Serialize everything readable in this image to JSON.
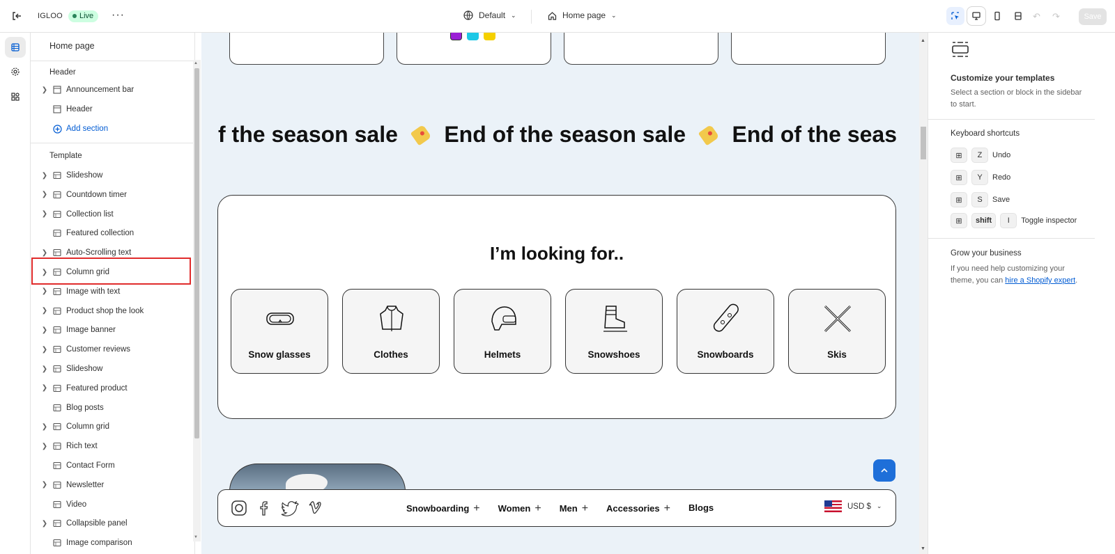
{
  "topbar": {
    "store_name": "IGLOO",
    "status": "Live",
    "more": "···",
    "theme_selector": "Default",
    "page_selector": "Home page",
    "save_label": "Save"
  },
  "sidebar": {
    "title": "Home page",
    "header_group": "Header",
    "header_items": [
      {
        "label": "Announcement bar",
        "expandable": true,
        "icon": "layout-icon"
      },
      {
        "label": "Header",
        "expandable": false,
        "icon": "layout-icon"
      }
    ],
    "add_section": "Add section",
    "template_group": "Template",
    "template_items": [
      {
        "label": "Slideshow",
        "expandable": true
      },
      {
        "label": "Countdown timer",
        "expandable": true
      },
      {
        "label": "Collection list",
        "expandable": true
      },
      {
        "label": "Featured collection",
        "expandable": false
      },
      {
        "label": "Auto-Scrolling text",
        "expandable": true
      },
      {
        "label": "Column grid",
        "expandable": true
      },
      {
        "label": "Image with text",
        "expandable": true
      },
      {
        "label": "Product shop the look",
        "expandable": true
      },
      {
        "label": "Image banner",
        "expandable": true
      },
      {
        "label": "Customer reviews",
        "expandable": true
      },
      {
        "label": "Slideshow",
        "expandable": true
      },
      {
        "label": "Featured product",
        "expandable": true
      },
      {
        "label": "Blog posts",
        "expandable": false
      },
      {
        "label": "Column grid",
        "expandable": true
      },
      {
        "label": "Rich text",
        "expandable": true
      },
      {
        "label": "Contact Form",
        "expandable": false
      },
      {
        "label": "Newsletter",
        "expandable": true
      },
      {
        "label": "Video",
        "expandable": false
      },
      {
        "label": "Collapsible panel",
        "expandable": true
      },
      {
        "label": "Image comparison",
        "expandable": false
      }
    ]
  },
  "preview": {
    "marquee_text": "End of the season sale",
    "marquee_partial_start": "f the season sale",
    "marquee_partial_end": "End of the seas",
    "looking_for_title": "I’m looking for..",
    "categories": [
      {
        "label": "Snow glasses",
        "icon": "goggles-icon"
      },
      {
        "label": "Clothes",
        "icon": "jacket-icon"
      },
      {
        "label": "Helmets",
        "icon": "helmet-icon"
      },
      {
        "label": "Snowshoes",
        "icon": "boot-icon"
      },
      {
        "label": "Snowboards",
        "icon": "snowboard-icon"
      },
      {
        "label": "Skis",
        "icon": "skis-icon"
      }
    ],
    "footer_nav": [
      "Snowboarding",
      "Women",
      "Men",
      "Accessories",
      "Blogs"
    ],
    "currency": "USD $",
    "dot_colors": [
      "#9b1fd6",
      "#1ec8e6",
      "#f5d000"
    ]
  },
  "right_panel": {
    "title": "Customize your templates",
    "subtitle": "Select a section or block in the sidebar to start.",
    "shortcuts_title": "Keyboard shortcuts",
    "shortcuts": [
      {
        "keys": [
          "Z"
        ],
        "action": "Undo"
      },
      {
        "keys": [
          "Y"
        ],
        "action": "Redo"
      },
      {
        "keys": [
          "S"
        ],
        "action": "Save"
      },
      {
        "keys": [
          "shift",
          "I"
        ],
        "action": "Toggle inspector"
      }
    ],
    "grow_title": "Grow your business",
    "grow_text": "If you need help customizing your theme, you can",
    "grow_link": "hire a Shopify expert",
    "grow_end": "."
  },
  "colors": {
    "accent": "#005bd3",
    "highlight": "#e02b2b",
    "preview_bg": "#ebf2f8"
  }
}
